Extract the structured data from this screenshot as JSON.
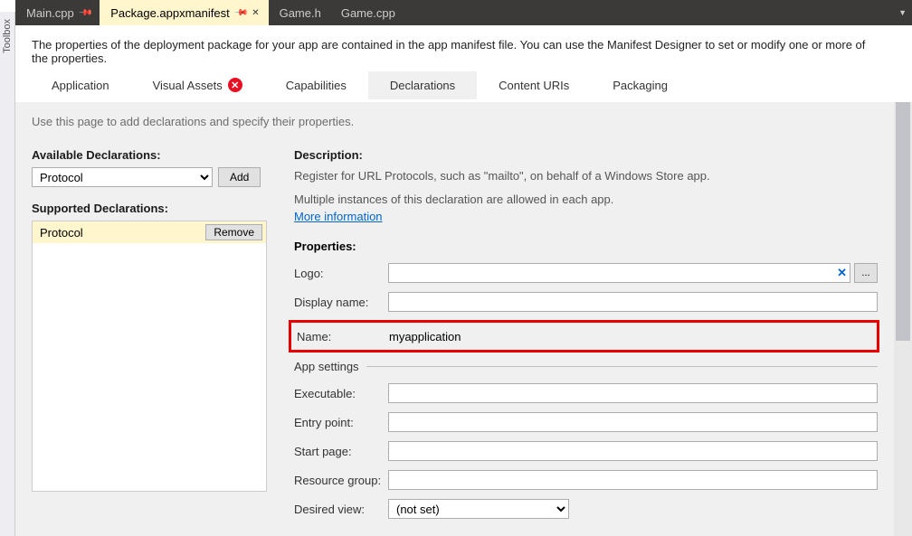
{
  "sidebar": {
    "toolbox_label": "Toolbox"
  },
  "tabs": {
    "items": [
      {
        "label": "Main.cpp"
      },
      {
        "label": "Package.appxmanifest"
      },
      {
        "label": "Game.h"
      },
      {
        "label": "Game.cpp"
      }
    ]
  },
  "description_strip": "The properties of the deployment package for your app are contained in the app manifest file. You can use the Manifest Designer to set or modify one or more of the properties.",
  "manifest_tabs": {
    "application": "Application",
    "visual_assets": "Visual Assets",
    "capabilities": "Capabilities",
    "declarations": "Declarations",
    "content_uris": "Content URIs",
    "packaging": "Packaging"
  },
  "intro": "Use this page to add declarations and specify their properties.",
  "available": {
    "heading": "Available Declarations:",
    "selected": "Protocol",
    "add_label": "Add"
  },
  "supported": {
    "heading": "Supported Declarations:",
    "item": "Protocol",
    "remove_label": "Remove"
  },
  "desc": {
    "heading": "Description:",
    "line1": "Register for URL Protocols, such as \"mailto\", on behalf of a Windows Store app.",
    "line2": "Multiple instances of this declaration are allowed in each app.",
    "more_info": "More information"
  },
  "props": {
    "heading": "Properties:",
    "logo_label": "Logo:",
    "logo_value": "",
    "browse_label": "...",
    "display_name_label": "Display name:",
    "display_name_value": "",
    "name_label": "Name:",
    "name_value": "myapplication",
    "app_settings_label": "App settings",
    "executable_label": "Executable:",
    "executable_value": "",
    "entry_point_label": "Entry point:",
    "entry_point_value": "",
    "start_page_label": "Start page:",
    "start_page_value": "",
    "resource_group_label": "Resource group:",
    "resource_group_value": "",
    "desired_view_label": "Desired view:",
    "desired_view_value": "(not set)"
  }
}
